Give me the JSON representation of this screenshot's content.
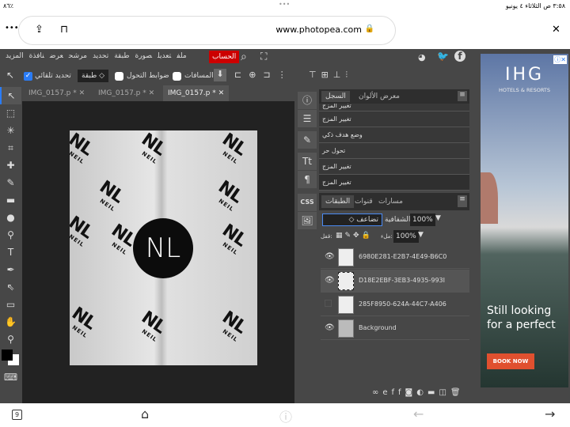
{
  "status": {
    "time_date": "٣:٥٨ ص  الثلاثاء ٤ يونيو",
    "battery": "٨٦٪",
    "dots": "•••"
  },
  "browser": {
    "url": "www.photopea.com",
    "more": "•••",
    "close": "✕"
  },
  "menu": [
    "ملف",
    "تعديل",
    "صورة",
    "طبقة",
    "تحديد",
    "مرشح",
    "عرض",
    "نافذة",
    "المزيد"
  ],
  "account": "الحساب",
  "options": {
    "auto_select": "تحديد تلقائي",
    "target": "طبقة",
    "transform_controls": "ضوابط التحول",
    "distances": "المسافات"
  },
  "tabs": [
    "IMG_0157.p *",
    "IMG_0157.p *",
    "IMG_0157.p *"
  ],
  "history_panel": {
    "tabs": [
      "السجل",
      "معرض الألوان"
    ],
    "items": [
      "تغيير المزج",
      "تغيير المزج",
      "وضع هدف ذكي",
      "تحول حر",
      "تغيير المزج",
      "تغيير المزج"
    ]
  },
  "layers_panel": {
    "tabs": [
      "الطبقات",
      "قنوات",
      "مسارات"
    ],
    "blend_mode": "تضاعف",
    "opacity_label": "الشفافية:",
    "opacity": "100%",
    "lock_label": "قفل:",
    "fill_label": "ملء:",
    "fill": "100%",
    "layers": [
      {
        "name": "6980E281-E2B7-4E49-B6C0",
        "visible": true
      },
      {
        "name": "D18E2EBF-3EB3-4935-993I",
        "visible": true,
        "selected": true
      },
      {
        "name": "285F8950-624A-44C7-A406",
        "visible": false
      },
      {
        "name": "Background",
        "visible": true
      }
    ]
  },
  "canvas": {
    "logo_text": "NL",
    "brand_text": "NEIL"
  },
  "ad": {
    "brand": "IHG",
    "sub": "HOTELS & RESORTS",
    "headline": "Still looking for a perfect",
    "cta": "BOOK NOW",
    "cta_color": "#e0502f"
  },
  "bottom": {
    "tabs_count": "9"
  }
}
